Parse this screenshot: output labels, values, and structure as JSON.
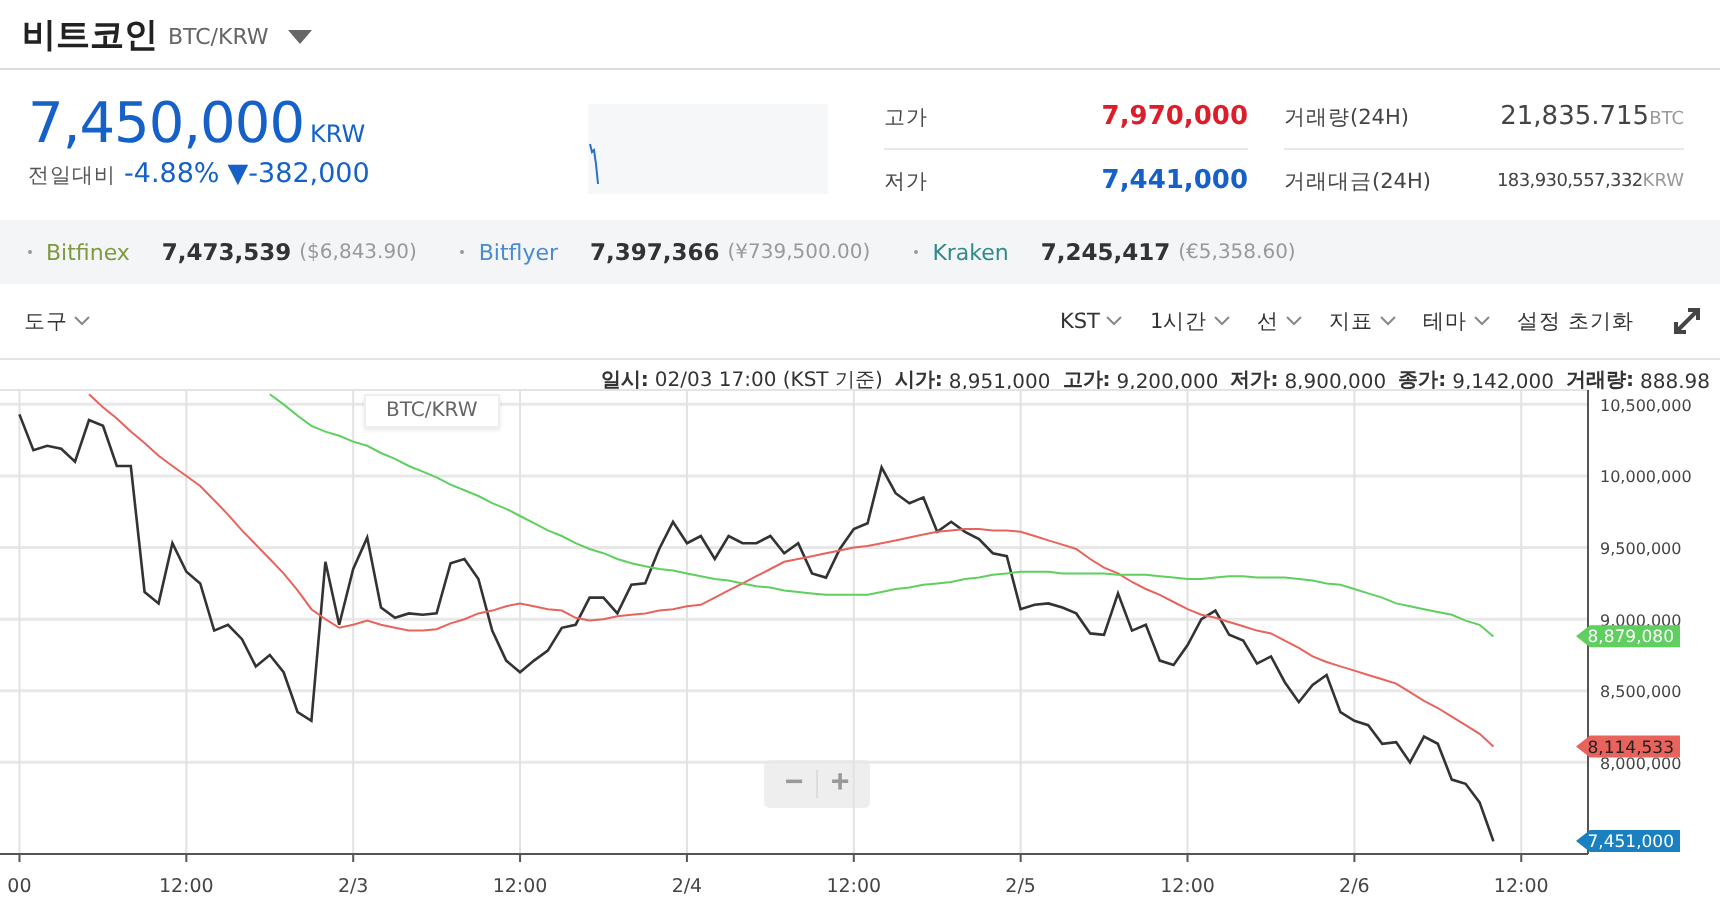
{
  "header": {
    "title": "비트코인",
    "pair": "BTC/KRW"
  },
  "price": {
    "value": "7,450,000",
    "unit": "KRW",
    "change_label": "전일대비",
    "change_pct": "-4.88%",
    "change_abs": "▼-382,000"
  },
  "stats": [
    {
      "label": "고가",
      "value": "7,970,000",
      "kind": "high"
    },
    {
      "label": "거래량(24H)",
      "value": "21,835.715",
      "unit": "BTC",
      "kind": "plain"
    },
    {
      "label": "저가",
      "value": "7,441,000",
      "kind": "low"
    },
    {
      "label": "거래대금(24H)",
      "value": "183,930,557,332",
      "unit": "KRW",
      "kind": "small"
    }
  ],
  "exchanges": [
    {
      "name": "Bitfinex",
      "color": "#7f9a3e",
      "price": "7,473,539",
      "foreign": "($6,843.90)"
    },
    {
      "name": "Bitflyer",
      "color": "#4a8ad0",
      "price": "7,397,366",
      "foreign": "(¥739,500.00)"
    },
    {
      "name": "Kraken",
      "color": "#2e8a8c",
      "price": "7,245,417",
      "foreign": "(€5,358.60)"
    }
  ],
  "toolbar": {
    "tools": "도구",
    "menus": [
      {
        "label": "KST"
      },
      {
        "label": "1시간"
      },
      {
        "label": "선"
      },
      {
        "label": "지표"
      },
      {
        "label": "테마"
      }
    ],
    "reset": "설정 초기화"
  },
  "info": [
    {
      "label": "일시:",
      "value": "02/03 17:00 (KST 기준)"
    },
    {
      "label": "시가:",
      "value": "8,951,000"
    },
    {
      "label": "고가:",
      "value": "9,200,000"
    },
    {
      "label": "저가:",
      "value": "8,900,000"
    },
    {
      "label": "종가:",
      "value": "9,142,000"
    },
    {
      "label": "거래량:",
      "value": "888.98"
    }
  ],
  "chart": {
    "zoom_out": "−",
    "zoom_in": "+",
    "chart_data": {
      "type": "line",
      "categories": [
        "00",
        null,
        null,
        null,
        null,
        null,
        null,
        null,
        null,
        null,
        null,
        null,
        "12:00",
        null,
        null,
        null,
        null,
        null,
        null,
        null,
        null,
        null,
        null,
        null,
        "2/3",
        null,
        null,
        null,
        null,
        null,
        null,
        null,
        null,
        null,
        null,
        null,
        "12:00",
        null,
        null,
        null,
        null,
        null,
        null,
        null,
        null,
        null,
        null,
        null,
        "2/4",
        null,
        null,
        null,
        null,
        null,
        null,
        null,
        null,
        null,
        null,
        null,
        "12:00",
        null,
        null,
        null,
        null,
        null,
        null,
        null,
        null,
        null,
        null,
        null,
        "2/5",
        null,
        null,
        null,
        null,
        null,
        null,
        null,
        null,
        null,
        null,
        null,
        "12:00",
        null,
        null,
        null,
        null,
        null,
        null,
        null,
        null,
        null,
        null,
        null,
        "2/6",
        null,
        null,
        null,
        null,
        null,
        null,
        null,
        null,
        null,
        null,
        null,
        "12:00"
      ],
      "ylim": [
        7360000,
        10600000
      ],
      "yticks": [
        {
          "value": 8000000,
          "label": "8,000,000"
        },
        {
          "value": 8500000,
          "label": "8,500,000"
        },
        {
          "value": 9000000,
          "label": "9,000,000"
        },
        {
          "value": 9500000,
          "label": "9,500,000"
        },
        {
          "value": 10000000,
          "label": "10,000,000"
        },
        {
          "value": 10500000,
          "label": "10,500,000"
        }
      ],
      "series": [
        {
          "name": "BTC/KRW",
          "color": "#333333",
          "values": [
            10430000,
            10180000,
            10210000,
            10190000,
            10100000,
            10390000,
            10350000,
            10070000,
            10070000,
            9190000,
            9110000,
            9530000,
            9330000,
            9250000,
            8920000,
            8960000,
            8860000,
            8670000,
            8750000,
            8630000,
            8350000,
            8290000,
            9400000,
            8960000,
            9350000,
            9570000,
            9080000,
            9010000,
            9040000,
            9030000,
            9040000,
            9390000,
            9420000,
            9280000,
            8920000,
            8710000,
            8630000,
            8710000,
            8780000,
            8940000,
            8960000,
            9150000,
            9150000,
            9040000,
            9240000,
            9250000,
            9490000,
            9680000,
            9530000,
            9580000,
            9420000,
            9580000,
            9530000,
            9530000,
            9580000,
            9460000,
            9530000,
            9320000,
            9290000,
            9490000,
            9630000,
            9670000,
            10060000,
            9880000,
            9810000,
            9850000,
            9610000,
            9680000,
            9610000,
            9560000,
            9460000,
            9440000,
            9070000,
            9100000,
            9110000,
            9080000,
            9040000,
            8900000,
            8890000,
            9180000,
            8920000,
            8960000,
            8710000,
            8680000,
            8820000,
            9000000,
            9060000,
            8890000,
            8850000,
            8690000,
            8740000,
            8560000,
            8420000,
            8540000,
            8610000,
            8350000,
            8290000,
            8260000,
            8130000,
            8140000,
            8000000,
            8180000,
            8130000,
            7880000,
            7850000,
            7720000,
            7450000,
            null,
            null
          ]
        },
        {
          "color": "#e8635c",
          "values": [
            null,
            null,
            null,
            null,
            null,
            10570000,
            10480000,
            10400000,
            10310000,
            10230000,
            10140000,
            10070000,
            10000000,
            9930000,
            9830000,
            9730000,
            9620000,
            9520000,
            9420000,
            9320000,
            9200000,
            9070000,
            9000000,
            8940000,
            8960000,
            8990000,
            8960000,
            8940000,
            8920000,
            8920000,
            8930000,
            8970000,
            9000000,
            9040000,
            9060000,
            9090000,
            9110000,
            9090000,
            9070000,
            9060000,
            9010000,
            8990000,
            9000000,
            9020000,
            9030000,
            9040000,
            9060000,
            9070000,
            9090000,
            9100000,
            9150000,
            9200000,
            9250000,
            9300000,
            9350000,
            9400000,
            9420000,
            9440000,
            9460000,
            9480000,
            9500000,
            9510000,
            9530000,
            9550000,
            9570000,
            9590000,
            9610000,
            9620000,
            9630000,
            9630000,
            9620000,
            9620000,
            9610000,
            9580000,
            9550000,
            9520000,
            9490000,
            9420000,
            9360000,
            9320000,
            9260000,
            9210000,
            9170000,
            9120000,
            9070000,
            9030000,
            9010000,
            8980000,
            8950000,
            8920000,
            8900000,
            8850000,
            8800000,
            8740000,
            8700000,
            8670000,
            8640000,
            8610000,
            8580000,
            8550000,
            8490000,
            8430000,
            8380000,
            8320000,
            8260000,
            8200000,
            8110000,
            null,
            null
          ]
        },
        {
          "color": "#5fcf5f",
          "values": [
            null,
            null,
            null,
            null,
            null,
            null,
            null,
            null,
            null,
            null,
            null,
            null,
            null,
            null,
            null,
            null,
            null,
            null,
            10570000,
            10500000,
            10420000,
            10350000,
            10310000,
            10280000,
            10240000,
            10210000,
            10160000,
            10120000,
            10070000,
            10030000,
            9990000,
            9940000,
            9900000,
            9860000,
            9810000,
            9770000,
            9720000,
            9670000,
            9620000,
            9580000,
            9530000,
            9490000,
            9460000,
            9420000,
            9390000,
            9370000,
            9350000,
            9340000,
            9320000,
            9300000,
            9280000,
            9270000,
            9250000,
            9230000,
            9220000,
            9200000,
            9190000,
            9180000,
            9170000,
            9170000,
            9170000,
            9170000,
            9190000,
            9210000,
            9220000,
            9240000,
            9250000,
            9260000,
            9280000,
            9290000,
            9310000,
            9320000,
            9330000,
            9330000,
            9330000,
            9320000,
            9320000,
            9320000,
            9320000,
            9310000,
            9310000,
            9310000,
            9300000,
            9290000,
            9280000,
            9280000,
            9290000,
            9300000,
            9300000,
            9290000,
            9290000,
            9290000,
            9280000,
            9270000,
            9250000,
            9240000,
            9210000,
            9180000,
            9150000,
            9110000,
            9090000,
            9070000,
            9050000,
            9030000,
            8990000,
            8960000,
            8880000,
            null,
            null
          ]
        }
      ],
      "grid": true,
      "annotations": [
        "8,879,080",
        "8,114,533",
        "7,451,000"
      ]
    }
  }
}
